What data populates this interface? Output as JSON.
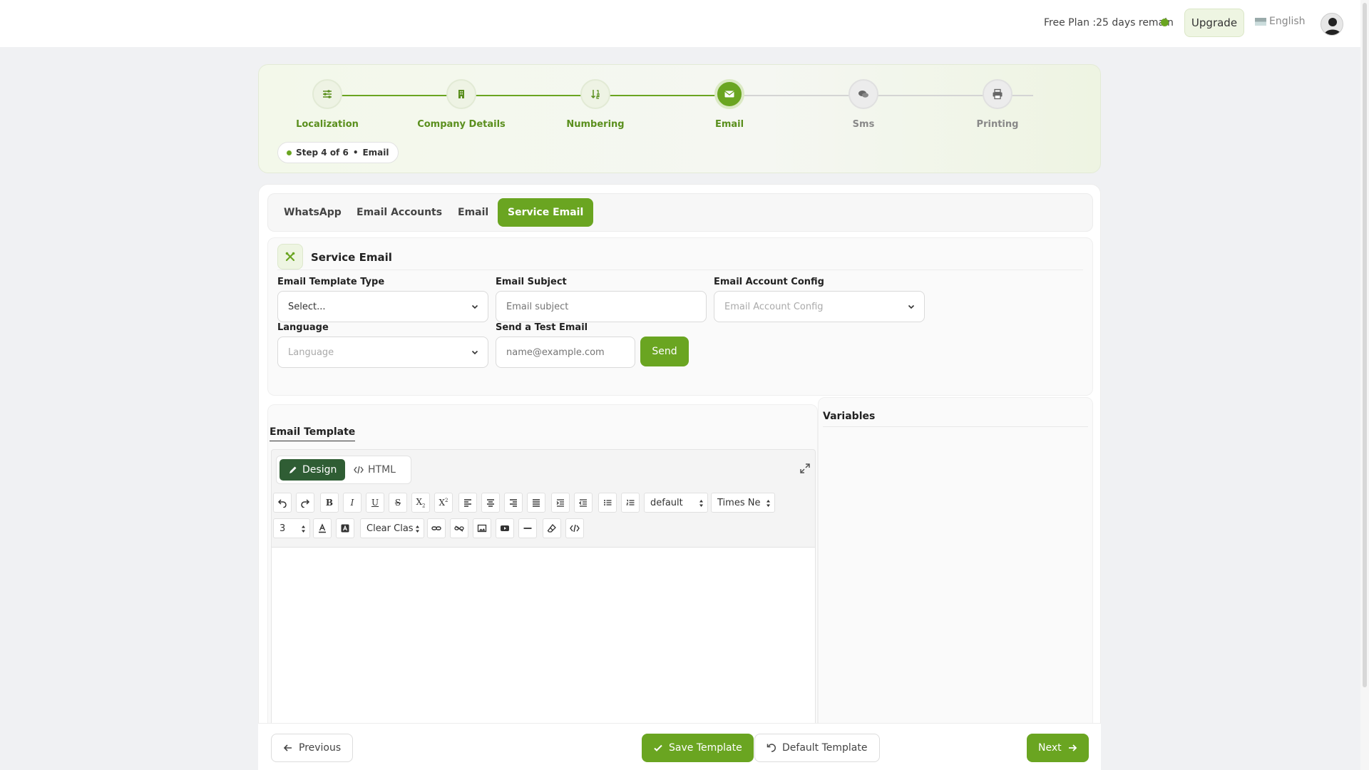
{
  "header": {
    "plan_text": "Free Plan :25 days remain",
    "upgrade_label": "Upgrade",
    "language_label": "English"
  },
  "stepper": {
    "steps": [
      {
        "label": "Localization",
        "icon": "sliders-icon",
        "state": "done"
      },
      {
        "label": "Company Details",
        "icon": "building-icon",
        "state": "done"
      },
      {
        "label": "Numbering",
        "icon": "sort-numeric-icon",
        "state": "done"
      },
      {
        "label": "Email",
        "icon": "envelope-icon",
        "state": "active"
      },
      {
        "label": "Sms",
        "icon": "chat-bubbles-icon",
        "state": "pending"
      },
      {
        "label": "Printing",
        "icon": "printer-icon",
        "state": "pending"
      }
    ],
    "badge_step": "Step 4 of 6",
    "badge_sep": "•",
    "badge_name": "Email"
  },
  "tabs": [
    {
      "label": "WhatsApp",
      "active": false
    },
    {
      "label": "Email Accounts",
      "active": false
    },
    {
      "label": "Email",
      "active": false
    },
    {
      "label": "Service Email",
      "active": true
    }
  ],
  "form": {
    "section_title": "Service Email",
    "template_type": {
      "label": "Email Template Type",
      "value": "Select..."
    },
    "subject": {
      "label": "Email Subject",
      "placeholder": "Email subject"
    },
    "account_config": {
      "label": "Email Account Config",
      "placeholder": "Email Account Config"
    },
    "language": {
      "label": "Language",
      "placeholder": "Language"
    },
    "test_email": {
      "label": "Send a Test Email",
      "placeholder": "name@example.com"
    },
    "send_label": "Send"
  },
  "editor": {
    "title": "Email Template",
    "design_label": "Design",
    "html_label": "HTML",
    "style_select": "default",
    "font_select": "Times Ne",
    "size_select": "3",
    "class_select": "Clear Clas"
  },
  "variables": {
    "title": "Variables"
  },
  "footer": {
    "previous_label": "Previous",
    "save_label": "Save Template",
    "default_label": "Default Template",
    "next_label": "Next"
  },
  "colors": {
    "accent": "#6aa521",
    "dark_green": "#2f5d34"
  }
}
